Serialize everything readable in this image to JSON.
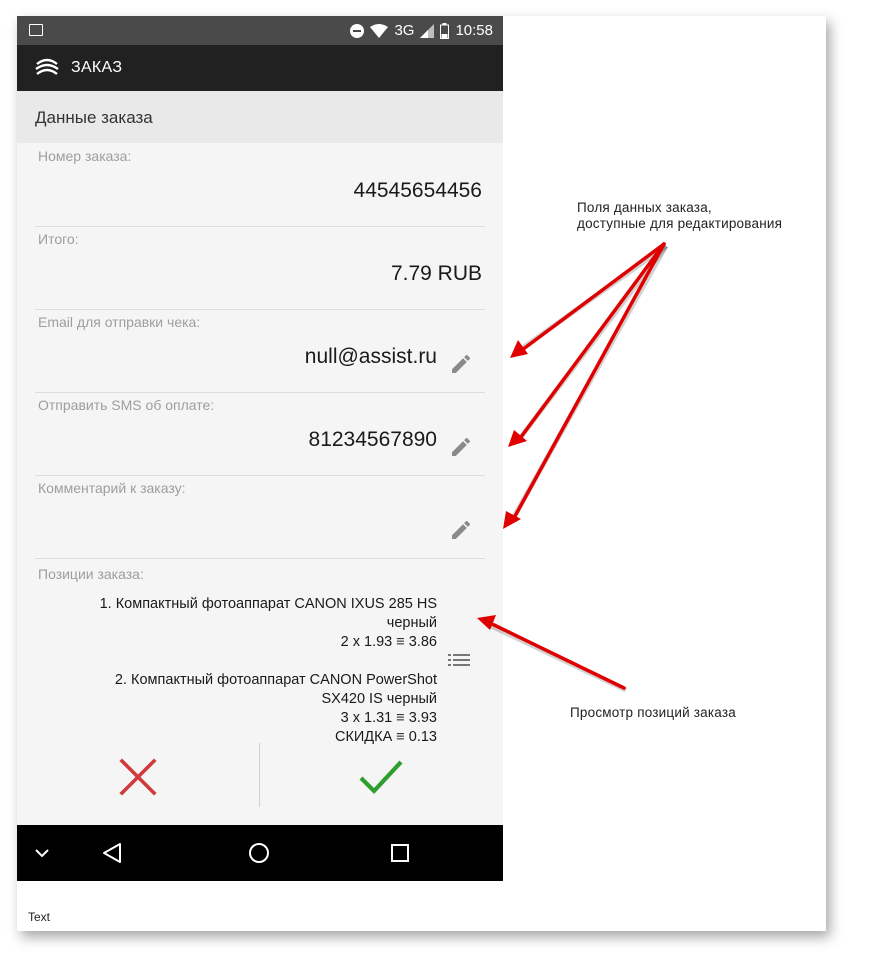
{
  "status_bar": {
    "network": "3G",
    "time": "10:58"
  },
  "app_bar": {
    "title": "ЗАКАЗ"
  },
  "section": {
    "title": "Данные заказа"
  },
  "fields": [
    {
      "label": "Номер заказа:",
      "value": "44545654456",
      "editable": false
    },
    {
      "label": "Итого:",
      "value": "7.79 RUB",
      "editable": false
    },
    {
      "label": "Email для отправки чека:",
      "value": "null@assist.ru",
      "editable": true
    },
    {
      "label": "Отправить SMS об оплате:",
      "value": "81234567890",
      "editable": true
    },
    {
      "label": "Комментарий к заказу:",
      "value": "",
      "editable": true
    }
  ],
  "positions": {
    "label": "Позиции заказа:",
    "lines": [
      "1. Компактный фотоаппарат CANON IXUS 285 HS",
      "черный",
      "2 x 1.93 ≡ 3.86",
      "2. Компактный фотоаппарат CANON PowerShot",
      "SX420 IS черный",
      "3 x 1.31 ≡ 3.93",
      "СКИДКА ≡ 0.13"
    ]
  },
  "annotations": {
    "editable_fields_line1": "Поля данных заказа,",
    "editable_fields_line2": "доступные для редактирования",
    "positions_view": "Просмотр позиций заказа"
  },
  "footer": {
    "text": "Text"
  },
  "colors": {
    "status_bar": "#4a4a4a",
    "app_bar": "#212121",
    "cancel": "#d03a3a",
    "confirm": "#2e9e2e",
    "arrow": "#e00000"
  }
}
